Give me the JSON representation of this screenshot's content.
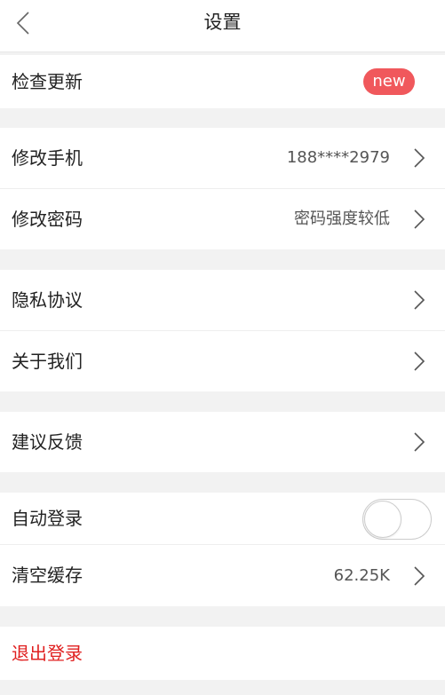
{
  "header": {
    "title": "设置",
    "back_icon": "chevron-left-icon"
  },
  "groups": [
    {
      "items": [
        {
          "label": "检查更新",
          "badge": "new"
        }
      ]
    },
    {
      "items": [
        {
          "label": "修改手机",
          "value": "188****2979",
          "icon": "chevron-right-icon"
        },
        {
          "label": "修改密码",
          "value": "密码强度较低",
          "icon": "chevron-right-icon"
        }
      ]
    },
    {
      "items": [
        {
          "label": "隐私协议",
          "icon": "chevron-right-icon"
        },
        {
          "label": "关于我们",
          "icon": "chevron-right-icon"
        }
      ]
    },
    {
      "items": [
        {
          "label": "建议反馈",
          "icon": "chevron-right-icon"
        }
      ]
    },
    {
      "items": [
        {
          "label": "自动登录",
          "toggle": false
        },
        {
          "label": "清空缓存",
          "value": "62.25K",
          "icon": "chevron-right-icon"
        }
      ]
    },
    {
      "items": [
        {
          "label": "退出登录"
        }
      ]
    }
  ],
  "colors": {
    "accent_red": "#e02020",
    "badge_bg": "#f0585c",
    "background": "#f2f2f2",
    "card": "#ffffff"
  }
}
